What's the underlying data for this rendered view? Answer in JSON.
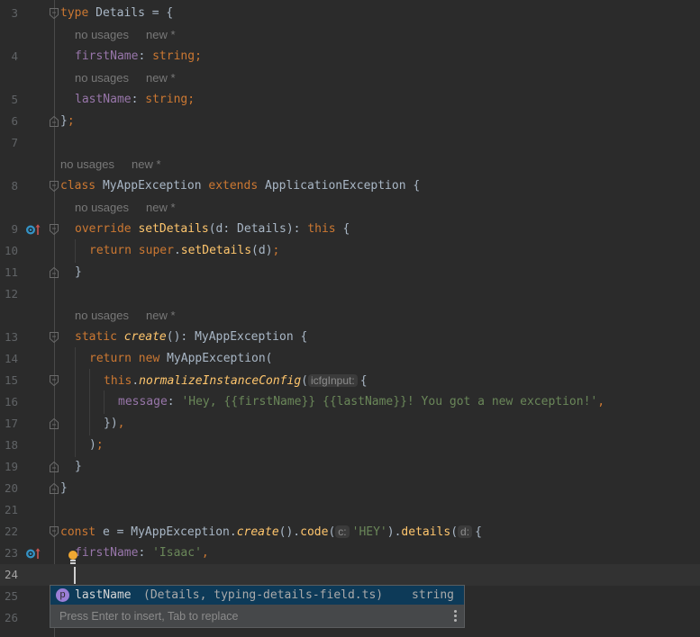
{
  "editor": {
    "hints": {
      "usages": "no usages",
      "new": "new *"
    },
    "lines": {
      "l3": {
        "num": "3",
        "kw": "type",
        "rest": " Details = {"
      },
      "l4": {
        "num": "4",
        "prop": "firstName",
        "colon": ": ",
        "type": "string",
        "semi": ";"
      },
      "l5": {
        "num": "5",
        "prop": "lastName",
        "colon": ": ",
        "type": "string",
        "semi": ";"
      },
      "l6": {
        "num": "6",
        "brace": "}",
        "semi": ";"
      },
      "l7": {
        "num": "7"
      },
      "l8": {
        "num": "8",
        "kw1": "class",
        "name": " MyAppException ",
        "kw2": "extends",
        "rest": " ApplicationException {"
      },
      "l9": {
        "num": "9",
        "kw": "override",
        "fn": "setDetails",
        "rest": "(d: Details): ",
        "kw2": "this",
        "end": " {"
      },
      "l10": {
        "num": "10",
        "kw": "return",
        "fn": "super",
        "dot": ".",
        "fn2": "setDetails",
        "rest": "(d)",
        "semi": ";"
      },
      "l11": {
        "num": "11",
        "brace": "}"
      },
      "l12": {
        "num": "12"
      },
      "l13": {
        "num": "13",
        "kw": "static",
        "fn": "create",
        "rest": "(): MyAppException {"
      },
      "l14": {
        "num": "14",
        "kw": "return",
        "kw2": "new",
        "rest": " MyAppException("
      },
      "l15": {
        "num": "15",
        "kw": "this",
        "dot": ".",
        "fn": "normalizeInstanceConfig",
        "paren": "(",
        "inlay": "icfgInput:",
        "rest": "{"
      },
      "l16": {
        "num": "16",
        "prop": "message",
        "colon": ": ",
        "str": "'Hey, {{firstName}} {{lastName}}! You got a new exception!'",
        "comma": ","
      },
      "l17": {
        "num": "17",
        "rest": "})",
        "comma": ","
      },
      "l18": {
        "num": "18",
        "rest": ")",
        "semi": ";"
      },
      "l19": {
        "num": "19",
        "brace": "}"
      },
      "l20": {
        "num": "20",
        "brace": "}"
      },
      "l21": {
        "num": "21"
      },
      "l22": {
        "num": "22",
        "kw": "const",
        "a": " e = MyAppException.",
        "fn": "create",
        "b": "().",
        "fn2": "code",
        "c": "(",
        "inlay1": "c:",
        "str": "'HEY'",
        "d": ").",
        "fn3": "details",
        "e": "(",
        "inlay2": "d:",
        "f": "{"
      },
      "l23": {
        "num": "23",
        "prop": "firstName",
        "colon": ": ",
        "str": "'Isaac'",
        "comma": ","
      },
      "l24": {
        "num": "24"
      },
      "l25": {
        "num": "25"
      },
      "l26": {
        "num": "26"
      }
    }
  },
  "completion": {
    "icon": "p",
    "name": "lastName",
    "location": "(Details, typing-details-field.ts)",
    "type": "string",
    "footer": "Press Enter to insert, Tab to replace"
  }
}
